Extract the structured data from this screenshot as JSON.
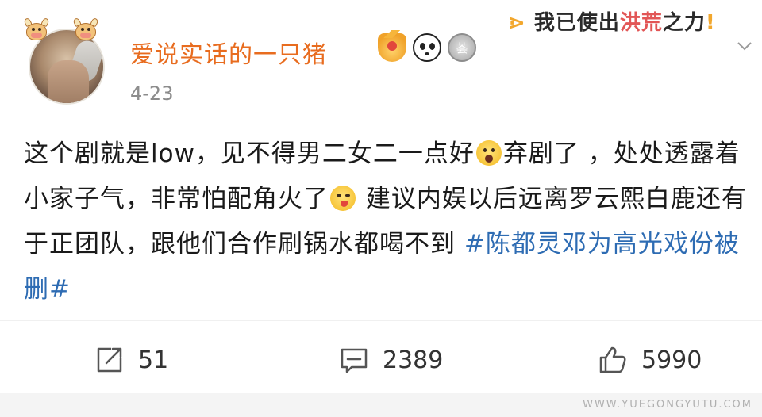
{
  "post": {
    "username": "爱说实话的一只猪",
    "date": "4-23",
    "banner": {
      "prefix": "我已使出",
      "highlight": "洪荒",
      "suffix": "之力"
    },
    "content": {
      "part1": "这个剧就是low，见不得男二女二一点好",
      "part2": "弃剧了 ，处处透露着小家子气，非常怕配角火了",
      "part3": " 建议内娱以后远离罗云熙白鹿还有于正团队，跟他们合作刷锅水都喝不到 ",
      "hashtag": "#陈都灵邓为高光戏份被删#"
    },
    "emojis": [
      "scream-emoji",
      "yum-emoji"
    ],
    "badges": [
      "crown-badge",
      "panda-badge",
      "medal-badge"
    ],
    "actions": {
      "repost_count": "51",
      "comment_count": "2389",
      "like_count": "5990"
    },
    "watermark": "WWW.YUEGONGYUTU.COM",
    "colors": {
      "username": "#e86c1f",
      "hashtag": "#2e6cb3",
      "date": "#8c8c8c"
    }
  }
}
